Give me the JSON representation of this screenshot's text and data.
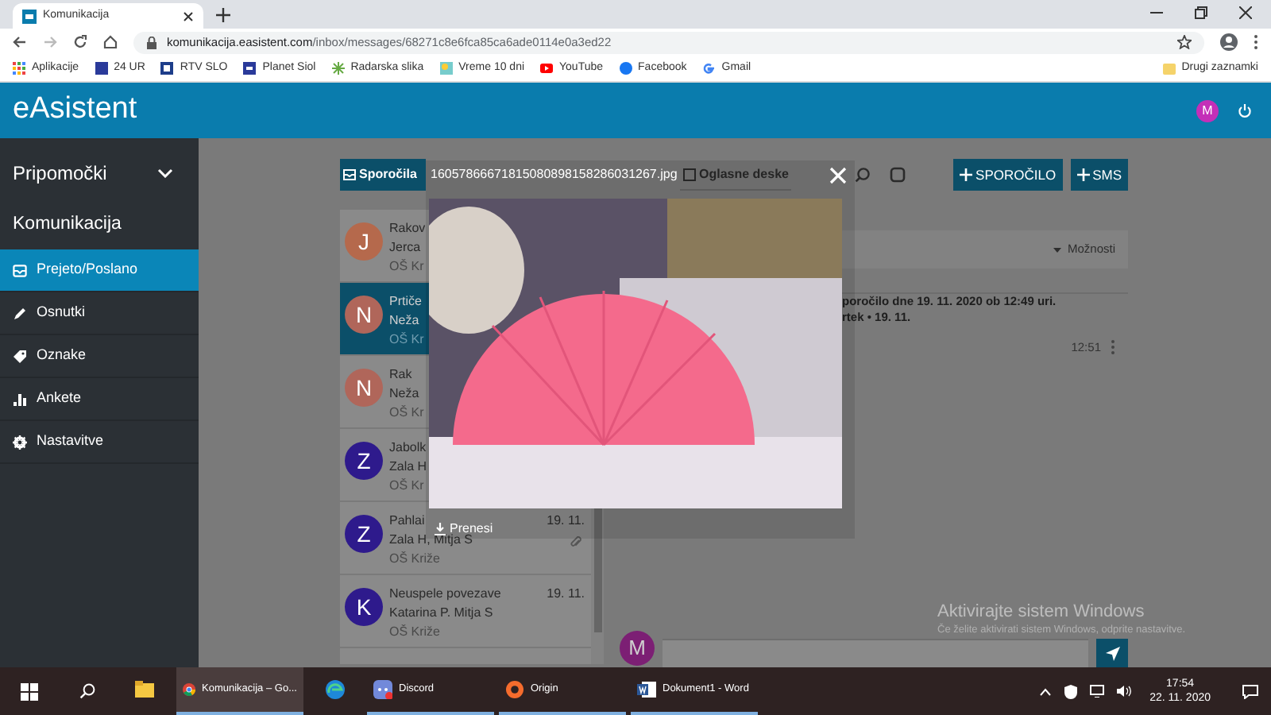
{
  "browser": {
    "tabs": [
      {
        "title": "Komunikacija",
        "selected": true
      }
    ],
    "address": {
      "domain": "komunikacija.easistent.com",
      "path": "/inbox/messages/68271c8e6fca85ca6ade0114e0a3ed22"
    },
    "bookmarks": [
      {
        "label": "Aplikacije"
      },
      {
        "label": "24 UR"
      },
      {
        "label": "RTV SLO"
      },
      {
        "label": "Planet Siol"
      },
      {
        "label": "Radarska slika"
      },
      {
        "label": "Vreme 10 dni"
      },
      {
        "label": "YouTube"
      },
      {
        "label": "Facebook"
      },
      {
        "label": "Gmail"
      }
    ],
    "other_bookmarks": "Drugi zaznamki"
  },
  "app": {
    "title": "eAsistent",
    "user_initial": "M"
  },
  "sidebar": {
    "section": "Pripomočki",
    "heading": "Komunikacija",
    "items": [
      {
        "label": "Prejeto/Poslano",
        "selected": true
      },
      {
        "label": "Osnutki",
        "selected": false
      },
      {
        "label": "Oznake",
        "selected": false
      },
      {
        "label": "Ankete",
        "selected": false
      },
      {
        "label": "Nastavitve",
        "selected": false
      }
    ]
  },
  "inbox": {
    "tabs": [
      {
        "label": "Sporočila",
        "selected": true
      },
      {
        "label": "Oglasne deske",
        "selected": false
      }
    ],
    "buttons": [
      "SPOROČILO",
      "SMS"
    ],
    "messages": [
      {
        "initial": "J",
        "color": "#b5694c",
        "subject": "Rakov",
        "participants": "Jerca",
        "school": "OŠ Kr",
        "selected": false
      },
      {
        "initial": "N",
        "color": "#b0665a",
        "subject": "Prtiče",
        "participants": "Neža",
        "school": "OŠ Kr",
        "selected": true
      },
      {
        "initial": "N",
        "color": "#b0665a",
        "subject": "Rak",
        "participants": "Neža",
        "school": "OŠ Kr",
        "selected": false
      },
      {
        "initial": "Z",
        "color": "#2e1a8c",
        "subject": "Jabolk",
        "participants": "Zala H",
        "school": "OŠ Kr",
        "selected": false
      },
      {
        "initial": "Z",
        "color": "#2e1a8c",
        "subject": "Pahlai",
        "participants": "Zala H, Mitja S",
        "school": "OŠ Križe",
        "date": "19. 11.",
        "selected": false,
        "attachment": true
      },
      {
        "initial": "K",
        "color": "#2e1a8c",
        "subject": "Neuspele povezave",
        "participants": "Katarina P. Mitja S",
        "school": "OŠ Križe",
        "date": "19. 11.",
        "selected": false,
        "attachment": false
      }
    ],
    "options": "Možnosti",
    "info_lines": [
      "poročilo dne 19. 11. 2020 ob 12:49 uri.",
      "rtek • 19. 11."
    ],
    "time": "12:51",
    "composer_initial": "M"
  },
  "viewer": {
    "filename": "16057866671815080898158286031267.jpg",
    "download": "Prenesi"
  },
  "windows_notice": {
    "title": "Aktivirajte sistem Windows",
    "text": "Če želite aktivirati sistem Windows, odprite nastavitve."
  },
  "taskbar": {
    "apps": [
      {
        "open": false,
        "selected": false
      },
      {
        "label": "Komunikacija – Go...",
        "open": true,
        "selected": true
      },
      {
        "open": false,
        "selected": false
      },
      {
        "label": "Discord",
        "open": true,
        "selected": false
      },
      {
        "label": "Origin",
        "open": true,
        "selected": false
      },
      {
        "label": "Dokument1 - Word",
        "open": true,
        "selected": false
      }
    ],
    "time": "17:54",
    "date": "22. 11. 2020"
  }
}
